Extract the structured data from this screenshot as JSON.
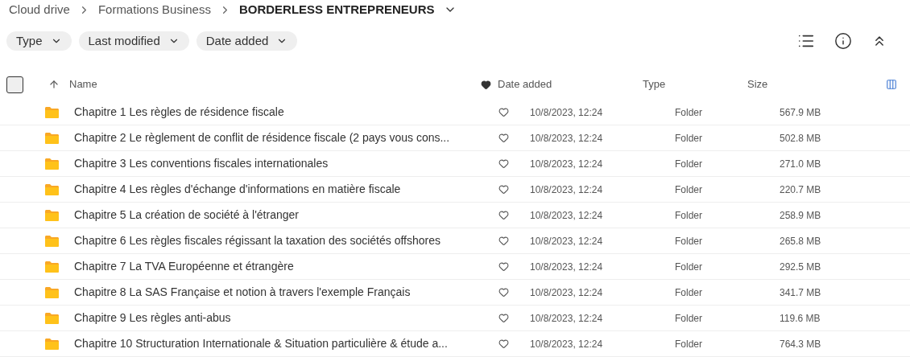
{
  "breadcrumb": [
    {
      "label": "Cloud drive",
      "current": false
    },
    {
      "label": "Formations Business",
      "current": false
    },
    {
      "label": "BORDERLESS ENTREPRENEURS",
      "current": true
    }
  ],
  "filters": [
    {
      "label": "Type"
    },
    {
      "label": "Last modified"
    },
    {
      "label": "Date added"
    }
  ],
  "table": {
    "select_all": {
      "checked": false
    },
    "columns": [
      {
        "label": "Name",
        "sorted": true
      },
      {
        "label": "Date added",
        "sorted": false
      },
      {
        "label": "Type",
        "sorted": false
      },
      {
        "label": "Size",
        "sorted": false
      }
    ],
    "rows": [
      {
        "name": "Chapitre 1 Les règles de résidence fiscale",
        "favorite": false,
        "date_added": "10/8/2023, 12:24",
        "type": "Folder",
        "size": "567.9 MB"
      },
      {
        "name": "Chapitre 2 Le règlement de conflit de résidence fiscale (2 pays vous cons...",
        "favorite": false,
        "date_added": "10/8/2023, 12:24",
        "type": "Folder",
        "size": "502.8 MB"
      },
      {
        "name": "Chapitre 3 Les conventions fiscales internationales",
        "favorite": false,
        "date_added": "10/8/2023, 12:24",
        "type": "Folder",
        "size": "271.0 MB"
      },
      {
        "name": "Chapitre 4 Les règles d'échange d'informations en matière fiscale",
        "favorite": false,
        "date_added": "10/8/2023, 12:24",
        "type": "Folder",
        "size": "220.7 MB"
      },
      {
        "name": "Chapitre 5 La création de société à l'étranger",
        "favorite": false,
        "date_added": "10/8/2023, 12:24",
        "type": "Folder",
        "size": "258.9 MB"
      },
      {
        "name": "Chapitre 6 Les règles fiscales régissant la taxation des sociétés offshores",
        "favorite": false,
        "date_added": "10/8/2023, 12:24",
        "type": "Folder",
        "size": "265.8 MB"
      },
      {
        "name": "Chapitre 7 La TVA Européenne et étrangère",
        "favorite": false,
        "date_added": "10/8/2023, 12:24",
        "type": "Folder",
        "size": "292.5 MB"
      },
      {
        "name": "Chapitre 8 La SAS Française et notion à travers l'exemple Français",
        "favorite": false,
        "date_added": "10/8/2023, 12:24",
        "type": "Folder",
        "size": "341.7 MB"
      },
      {
        "name": "Chapitre 9 Les règles anti-abus",
        "favorite": false,
        "date_added": "10/8/2023, 12:24",
        "type": "Folder",
        "size": "119.6 MB"
      },
      {
        "name": "Chapitre 10 Structuration Internationale & Situation particulière & étude a...",
        "favorite": false,
        "date_added": "10/8/2023, 12:24",
        "type": "Folder",
        "size": "764.3 MB"
      }
    ]
  }
}
